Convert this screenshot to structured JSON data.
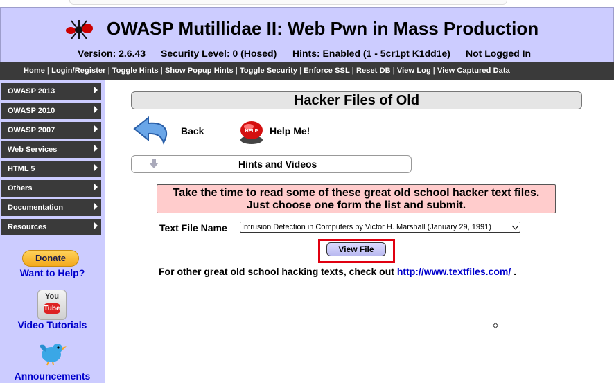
{
  "header": {
    "title": "OWASP Mutillidae II: Web Pwn in Mass Production",
    "version": "Version: 2.6.43",
    "security_level": "Security Level: 0 (Hosed)",
    "hints": "Hints: Enabled (1 - 5cr1pt K1dd1e)",
    "login_status": "Not Logged In"
  },
  "nav": {
    "items": [
      "Home",
      "Login/Register",
      "Toggle Hints",
      "Show Popup Hints",
      "Toggle Security",
      "Enforce SSL",
      "Reset DB",
      "View Log",
      "View Captured Data"
    ],
    "separator": "|"
  },
  "sidebar": {
    "menu": [
      "OWASP 2013",
      "OWASP 2010",
      "OWASP 2007",
      "Web Services",
      "HTML 5",
      "Others",
      "Documentation",
      "Resources"
    ],
    "donate_label": "Donate",
    "want_to_help": "Want to Help?",
    "youtube_you": "You",
    "youtube_tube": "Tube",
    "video_tutorials": "Video Tutorials",
    "announcements": "Announcements"
  },
  "main": {
    "page_title": "Hacker Files of Old",
    "back_label": "Back",
    "help_label": "Help Me!",
    "hints_label": "Hints and Videos",
    "notice_line1": "Take the time to read some of these great old school hacker text files.",
    "notice_line2": "Just choose one form the list and submit.",
    "file_label": "Text File Name",
    "file_selected": "Intrusion Detection in Computers by Victor H. Marshall (January 29, 1991)",
    "view_button": "View File",
    "footer_prefix": "For other great old school hacking texts, check out",
    "footer_link": "http://www.textfiles.com/",
    "footer_suffix": "."
  },
  "colors": {
    "header_bg": "#ccccff",
    "nav_bg": "#3a3a3a",
    "notice_bg": "#ffcccc",
    "highlight": "#e00010",
    "link": "#0000cc"
  }
}
